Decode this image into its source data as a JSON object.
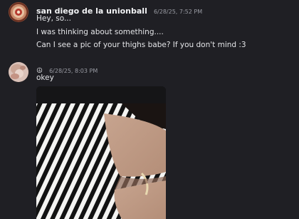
{
  "messages": [
    {
      "author": "san diego de la unionball",
      "timestamp": "6/28/25, 7:52 PM",
      "lines": [
        "Hey, so...",
        "I was thinking about something....",
        "Can I see a pic of your thighs babe? If you don't mind :3"
      ]
    },
    {
      "status_icon": "☮",
      "timestamp": "6/28/25, 8:03 PM",
      "lines": [
        "okey"
      ]
    }
  ]
}
